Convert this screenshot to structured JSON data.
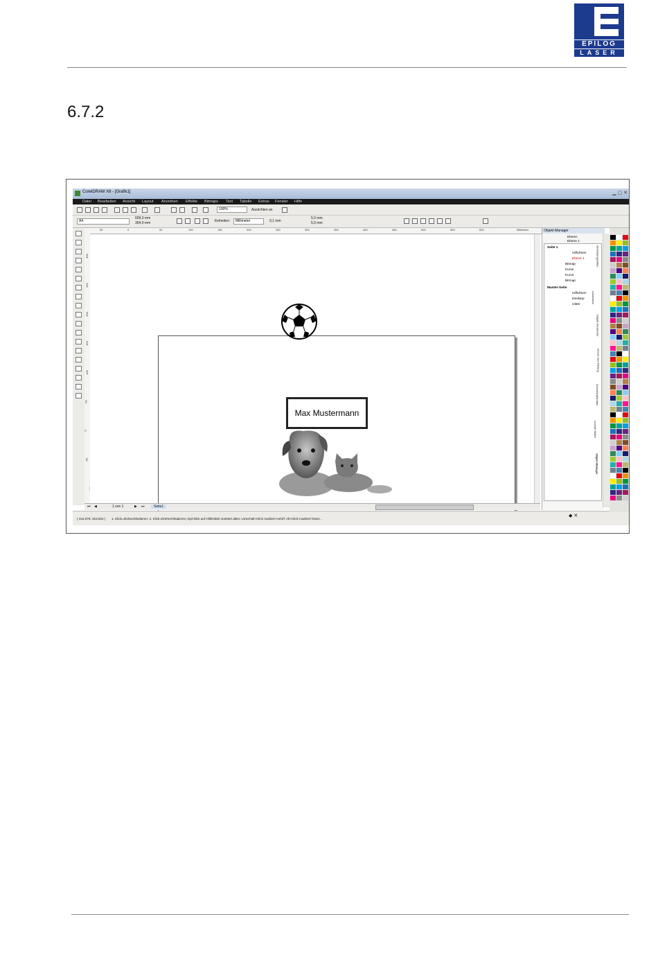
{
  "header": {
    "logo_line1": "EPILOG",
    "logo_line2": "LASER",
    "section_number": "6.7.2"
  },
  "screenshot": {
    "window_title": "CorelDRAW X6 - [Grafik1]",
    "menu": [
      "Datei",
      "Bearbeiten",
      "Ansicht",
      "Layout",
      "Anordnen",
      "Effekte",
      "Bitmaps",
      "Text",
      "Tabelle",
      "Extras",
      "Fenster",
      "Hilfe"
    ],
    "toolbar": {
      "zoom": "100%",
      "snap": "Ausrichten an",
      "page_size": "A4",
      "width": "609,0 mm",
      "height": "304,0 mm",
      "units_label": "Einheiten:",
      "units_value": "Millimeter",
      "nudge": "0,1 mm",
      "dup_x": "5,0 mm",
      "dup_y": "5,0 mm"
    },
    "ruler_h_ticks": [
      "50",
      "0",
      "50",
      "100",
      "150",
      "200",
      "250",
      "300",
      "350",
      "400",
      "450",
      "500",
      "550",
      "600"
    ],
    "ruler_h_unit": "Millimeter",
    "ruler_v_ticks": [
      "300",
      "250",
      "200",
      "150",
      "100",
      "50",
      "0",
      "-50"
    ],
    "ruler_v_unit": "Millimeter",
    "canvas_text": "Max Mustermann",
    "page_nav": {
      "counter": "1 von 1",
      "tab": "Seite1"
    },
    "status": {
      "coords": "( 444,076; 318,922 )",
      "hint": "1. Klick=Ziehen/Skalieren; 2. Klick=Drehen/Skalieren; Dpl-klick auf Hilfsmittel markiert alles; Umschalt+Klick markiert mehrf; Alt+Klick markiert hinter..."
    },
    "object_manager": {
      "title": "Objekt-Manager",
      "current_layer_label": "Ebene:",
      "current_layer": "Ebene 1",
      "rows": [
        {
          "label": "Seite 1",
          "kind": "page"
        },
        {
          "label": "Hilfslinien",
          "kind": "layer"
        },
        {
          "label": "Ebene 1",
          "kind": "active-layer"
        },
        {
          "label": "Bitmap",
          "kind": "object"
        },
        {
          "label": "Kurve",
          "kind": "object"
        },
        {
          "label": "Kurve",
          "kind": "object"
        },
        {
          "label": "Bitmap",
          "kind": "object"
        },
        {
          "label": "Master-Seite",
          "kind": "page"
        },
        {
          "label": "Hilfslinien",
          "kind": "layer"
        },
        {
          "label": "Desktop",
          "kind": "layer"
        },
        {
          "label": "Gitter",
          "kind": "layer"
        }
      ]
    },
    "docker_tabs": [
      "Verbindungshilfen",
      "Ausrichten",
      "Objekt-Parameter",
      "Umriss und Füllung",
      "Zeichenhilfsmittel",
      "Lineare Maße",
      "Objekt-Manager"
    ],
    "palette_colors": [
      "#000000",
      "#ffffff",
      "#e30613",
      "#f39200",
      "#ffed00",
      "#95c11f",
      "#009640",
      "#00a19a",
      "#009fe3",
      "#1d71b8",
      "#312783",
      "#662483",
      "#a3195b",
      "#e6007e",
      "#8a8a8a",
      "#cfcfcf",
      "#b17f4a",
      "#7d4e24",
      "#c8a2c8",
      "#4b0082",
      "#ff7f50",
      "#2e8b57",
      "#87cefa",
      "#191970",
      "#9acd32",
      "#ffc0cb",
      "#add8e6",
      "#20b2aa",
      "#ff1493",
      "#bdb76b",
      "#708090",
      "#4682b4"
    ]
  }
}
